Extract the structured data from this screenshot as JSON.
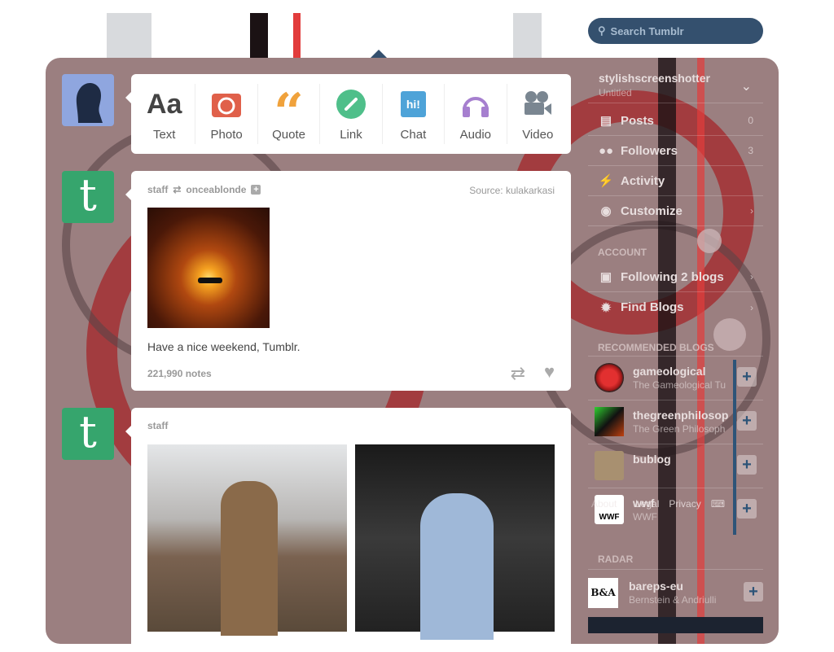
{
  "header": {
    "search_placeholder": "Search Tumblr"
  },
  "post_types": [
    {
      "label": "Text",
      "icon": "text-icon",
      "color": "#444444"
    },
    {
      "label": "Photo",
      "icon": "camera-icon",
      "color": "#e0604a"
    },
    {
      "label": "Quote",
      "icon": "quote-icon",
      "color": "#f0a23c"
    },
    {
      "label": "Link",
      "icon": "link-icon",
      "color": "#4fbf8a"
    },
    {
      "label": "Chat",
      "icon": "chat-icon",
      "color": "#4ea3d8"
    },
    {
      "label": "Audio",
      "icon": "headphones-icon",
      "color": "#a67fcf"
    },
    {
      "label": "Video",
      "icon": "video-camera-icon",
      "color": "#7a8691"
    }
  ],
  "chat_icon_text": "hi!",
  "posts": [
    {
      "author": "staff",
      "reblogged_from": "onceablonde",
      "source_label": "Source:",
      "source": "kulakarkasi",
      "caption": "Have a nice weekend, Tumblr.",
      "notes": "221,990 notes"
    },
    {
      "author": "staff"
    }
  ],
  "sidebar": {
    "blog_name": "stylishscreenshotter",
    "blog_title": "Untitled",
    "items": [
      {
        "label": "Posts",
        "count": "0"
      },
      {
        "label": "Followers",
        "count": "3"
      },
      {
        "label": "Activity"
      },
      {
        "label": "Customize"
      }
    ],
    "account_heading": "ACCOUNT",
    "account_items": [
      {
        "label": "Following 2 blogs"
      },
      {
        "label": "Find Blogs"
      }
    ],
    "recommended_heading": "RECOMMENDED BLOGS",
    "recommended": [
      {
        "name": "gameological",
        "title": "The Gameological Tu"
      },
      {
        "name": "thegreenphilosop",
        "title": "The Green Philosoph"
      },
      {
        "name": "bublog",
        "title": ""
      },
      {
        "name": "wwf",
        "title": "WWF"
      }
    ],
    "footer_links": [
      "About",
      "Legal",
      "Privacy"
    ],
    "radar_heading": "RADAR",
    "radar": {
      "name": "bareps-eu",
      "title": "Bernstein & Andriulli",
      "logo_text": "B&A"
    }
  }
}
